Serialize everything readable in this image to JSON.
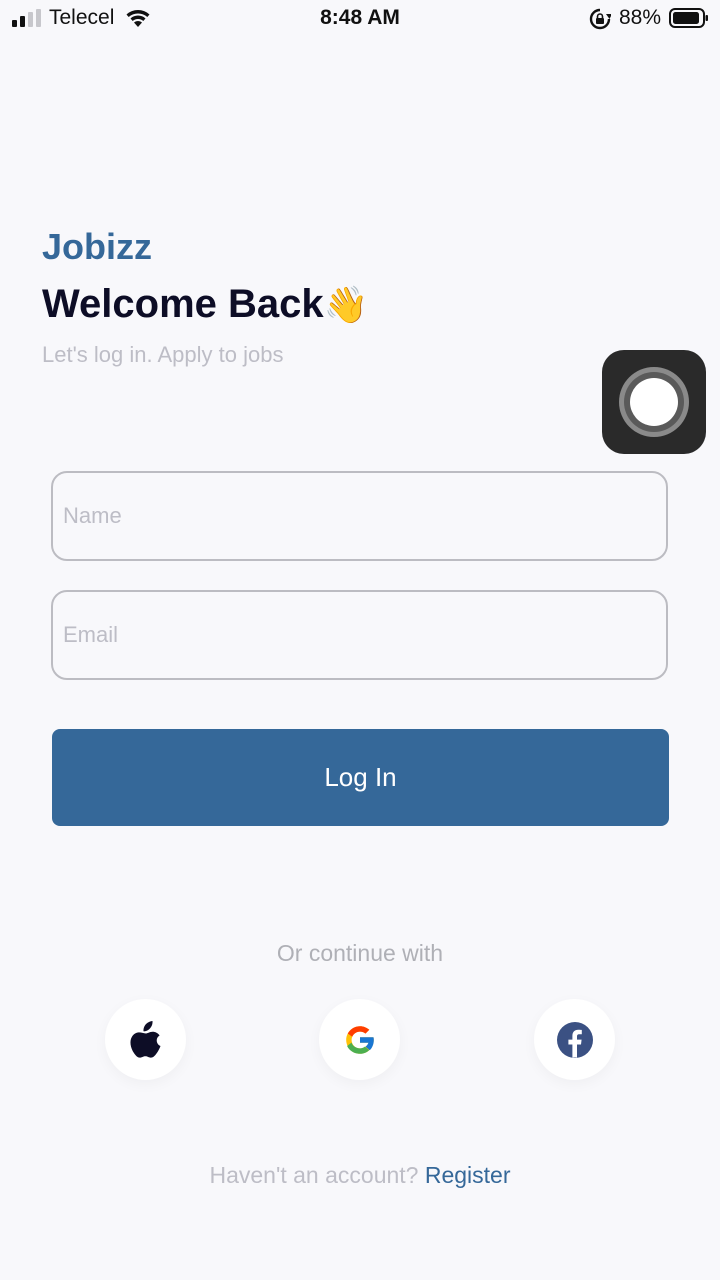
{
  "status_bar": {
    "carrier": "Telecel",
    "time": "8:48 AM",
    "battery_percent": "88%"
  },
  "header": {
    "brand": "Jobizz",
    "title": "Welcome Back",
    "title_emoji": "👋",
    "subtitle": "Let's log in. Apply to jobs"
  },
  "form": {
    "name_placeholder": "Name",
    "email_placeholder": "Email",
    "login_label": "Log In"
  },
  "social": {
    "divider_text": "Or continue with",
    "providers": [
      "apple-icon",
      "google-icon",
      "facebook-icon"
    ]
  },
  "footer": {
    "prompt": "Haven't an account?",
    "register_label": "Register"
  },
  "colors": {
    "brand": "#356899",
    "title": "#0d0d26",
    "muted": "#bdbdc6",
    "background": "#f8f8fb"
  }
}
